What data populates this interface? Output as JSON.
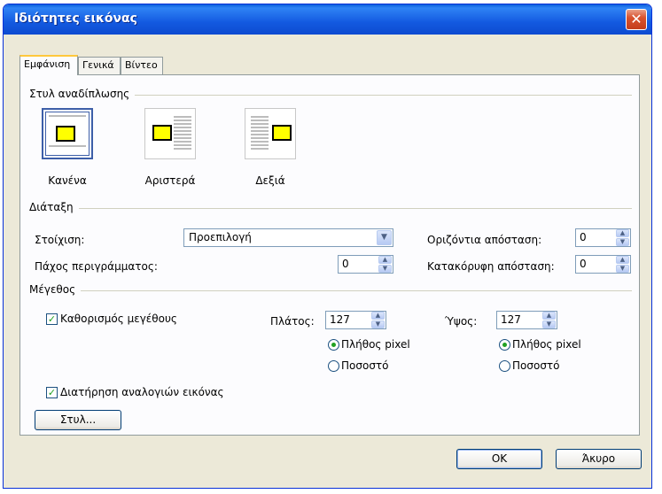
{
  "window": {
    "title": "Ιδιότητες εικόνας",
    "close_glyph": "✕"
  },
  "tabs": [
    {
      "label": "Εμφάνιση",
      "active": true
    },
    {
      "label": "Γενικά",
      "active": false
    },
    {
      "label": "Βίντεο",
      "active": false
    }
  ],
  "wrap_style": {
    "heading": "Στυλ αναδίπλωσης",
    "options": [
      {
        "label": "Κανένα",
        "selected": true
      },
      {
        "label": "Αριστερά",
        "selected": false
      },
      {
        "label": "Δεξιά",
        "selected": false
      }
    ]
  },
  "layout": {
    "heading": "Διάταξη",
    "alignment_label": "Στοίχιση:",
    "alignment_value": "Προεπιλογή",
    "border_label": "Πάχος περιγράμματος:",
    "border_value": "0",
    "hspace_label": "Οριζόντια απόσταση:",
    "hspace_value": "0",
    "vspace_label": "Κατακόρυφη απόσταση:",
    "vspace_value": "0"
  },
  "size": {
    "heading": "Μέγεθος",
    "specify_size_label": "Καθορισμός μεγέθους",
    "specify_size_checked": true,
    "width_label": "Πλάτος:",
    "width_value": "127",
    "height_label": "Ύψος:",
    "height_value": "127",
    "pixels_label": "Πλήθος pixel",
    "percent_label": "Ποσοστό",
    "keep_ratio_label": "Διατήρηση αναλογιών εικόνας",
    "keep_ratio_checked": true,
    "style_button": "Στυλ..."
  },
  "buttons": {
    "ok": "OK",
    "cancel": "Άκυρο"
  },
  "colors": {
    "titlebar": "#1359e0",
    "dialog_bg": "#ece9d8",
    "panel_bg": "#fcfcfe",
    "accent_tab": "#ffc83c",
    "check": "#21a121"
  }
}
